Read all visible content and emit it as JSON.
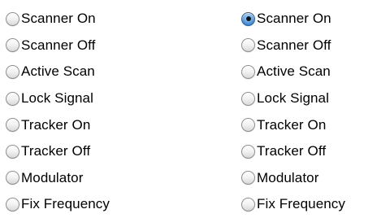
{
  "left_group": {
    "options": [
      {
        "label": "Scanner On",
        "selected": false
      },
      {
        "label": "Scanner Off",
        "selected": false
      },
      {
        "label": "Active Scan",
        "selected": false
      },
      {
        "label": "Lock Signal",
        "selected": false
      },
      {
        "label": "Tracker On",
        "selected": false
      },
      {
        "label": "Tracker Off",
        "selected": false
      },
      {
        "label": "Modulator",
        "selected": false
      },
      {
        "label": "Fix Frequency",
        "selected": false
      }
    ]
  },
  "right_group": {
    "options": [
      {
        "label": "Scanner On",
        "selected": true
      },
      {
        "label": "Scanner Off",
        "selected": false
      },
      {
        "label": "Active Scan",
        "selected": false
      },
      {
        "label": "Lock Signal",
        "selected": false
      },
      {
        "label": "Tracker On",
        "selected": false
      },
      {
        "label": "Tracker Off",
        "selected": false
      },
      {
        "label": "Modulator",
        "selected": false
      },
      {
        "label": "Fix Frequency",
        "selected": false
      }
    ]
  },
  "colors": {
    "selected_accent": "#3c86d3",
    "unselected_border": "#8e8e8e",
    "text": "#000000"
  },
  "icons": {
    "unselected": "radio-unchecked-icon",
    "selected": "radio-checked-icon"
  }
}
